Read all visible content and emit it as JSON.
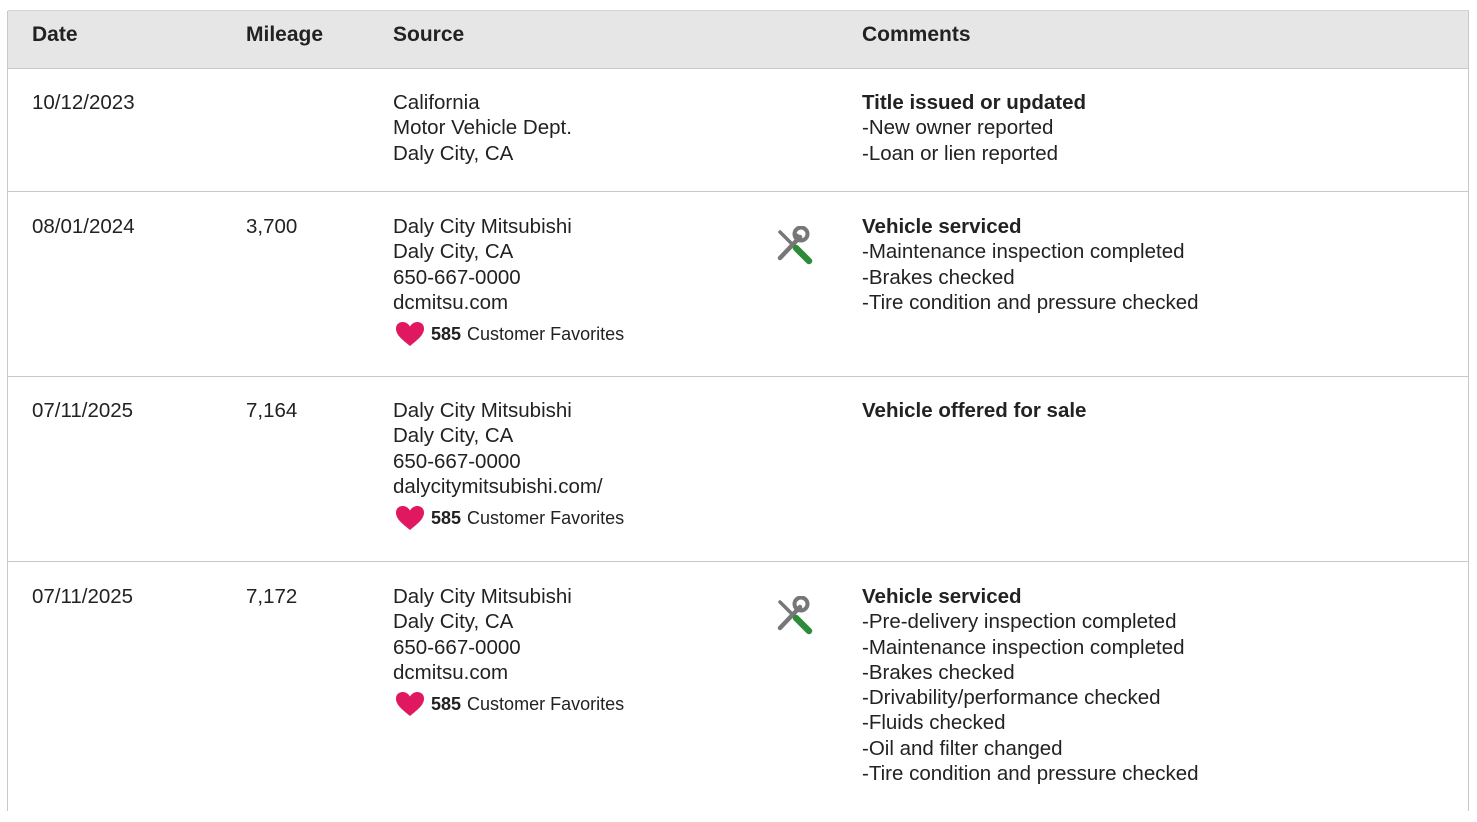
{
  "table": {
    "columns": {
      "date": "Date",
      "mileage": "Mileage",
      "source": "Source",
      "comments": "Comments"
    },
    "rows": [
      {
        "date": "10/12/2023",
        "mileage": "",
        "source": [
          "California",
          "Motor Vehicle Dept.",
          "Daly City, CA"
        ],
        "favorites": null,
        "icon": null,
        "comment_title": "Title issued or updated",
        "comment_items": [
          "-New owner reported",
          "-Loan or lien reported"
        ]
      },
      {
        "date": "08/01/2024",
        "mileage": "3,700",
        "source": [
          "Daly City Mitsubishi",
          "Daly City, CA",
          "650-667-0000",
          "dcmitsu.com"
        ],
        "favorites": {
          "count": "585",
          "label": "Customer Favorites"
        },
        "icon": "service-tools-icon",
        "comment_title": "Vehicle serviced",
        "comment_items": [
          "-Maintenance inspection completed",
          "-Brakes checked",
          "-Tire condition and pressure checked"
        ]
      },
      {
        "date": "07/11/2025",
        "mileage": "7,164",
        "source": [
          "Daly City Mitsubishi",
          "Daly City, CA",
          "650-667-0000",
          "dalycitymitsubishi.com/"
        ],
        "favorites": {
          "count": "585",
          "label": "Customer Favorites"
        },
        "icon": null,
        "comment_title": "Vehicle offered for sale",
        "comment_items": []
      },
      {
        "date": "07/11/2025",
        "mileage": "7,172",
        "source": [
          "Daly City Mitsubishi",
          "Daly City, CA",
          "650-667-0000",
          "dcmitsu.com"
        ],
        "favorites": {
          "count": "585",
          "label": "Customer Favorites"
        },
        "icon": "service-tools-icon",
        "comment_title": "Vehicle serviced",
        "comment_items": [
          "-Pre-delivery inspection completed",
          "-Maintenance inspection completed",
          "-Brakes checked",
          "-Drivability/performance checked",
          "-Fluids checked",
          "-Oil and filter changed",
          "-Tire condition and pressure checked"
        ]
      }
    ]
  },
  "colors": {
    "header_bg": "#e6e6e6",
    "heart": "#e0185f",
    "wrench": "#777777",
    "screwdriver": "#2e8b3a"
  }
}
